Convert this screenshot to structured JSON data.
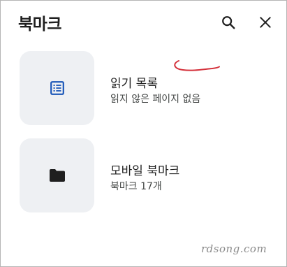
{
  "header": {
    "title": "북마크",
    "search_icon": "search-icon",
    "close_icon": "close-icon"
  },
  "items": [
    {
      "title": "읽기 목록",
      "subtitle": "읽지 않은 페이지 없음",
      "icon": "reading-list-icon",
      "icon_color": "#1a56b8"
    },
    {
      "title": "모바일 북마크",
      "subtitle": "북마크 17개",
      "icon": "folder-icon",
      "icon_color": "#1f1f1f"
    }
  ],
  "annotation_color": "#d4303a",
  "watermark": "rdsong.com"
}
